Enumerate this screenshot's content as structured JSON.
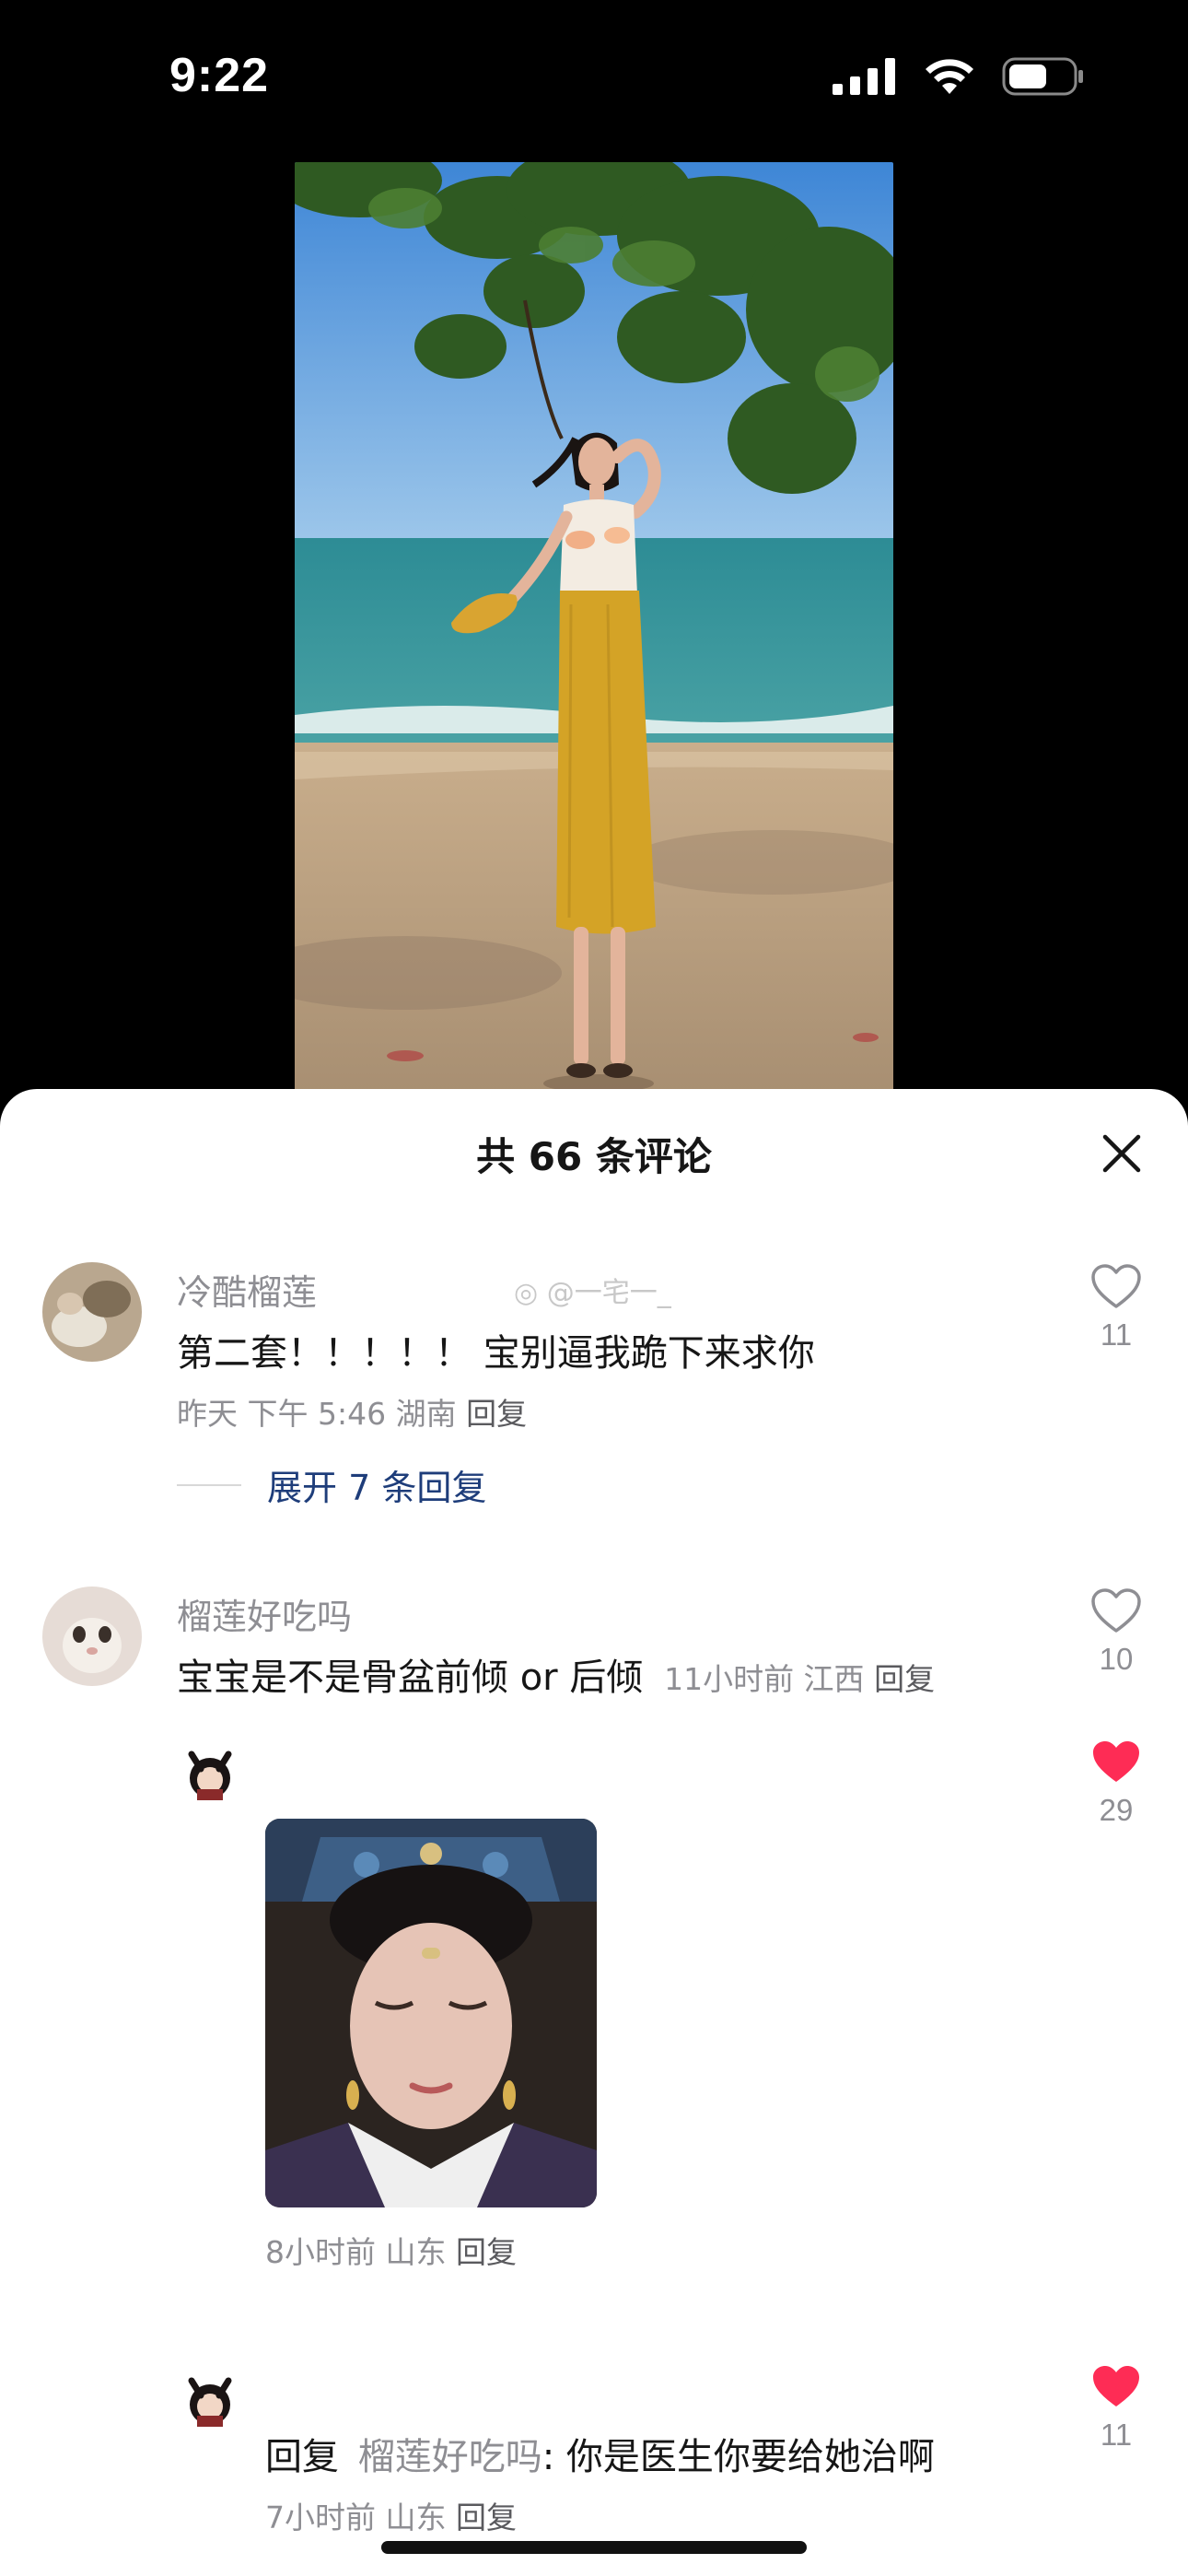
{
  "status_bar": {
    "time": "9:22"
  },
  "sheet": {
    "title": "共 66 条评论",
    "watermark": "@一宅一_"
  },
  "comments": [
    {
      "username": "冷酷榴莲",
      "text": "第二套！！！！！ 宝别逼我跪下来求你",
      "meta": "昨天 下午 5:46 湖南",
      "reply_label": "回复",
      "likes": "11",
      "liked": false,
      "expand_label": "展开 7 条回复"
    },
    {
      "username": "榴莲好吃吗",
      "text": "宝宝是不是骨盆前倾 or 后倾",
      "meta": "11小时前 江西",
      "reply_label": "回复",
      "likes": "10",
      "liked": false
    }
  ],
  "replies": [
    {
      "meta": "8小时前 山东",
      "reply_label": "回复",
      "likes": "29",
      "liked": true
    },
    {
      "reply_prefix": "回复",
      "reply_to": "榴莲好吃吗",
      "text": ": 你是医生你要给她治啊",
      "meta": "7小时前 山东",
      "reply_label": "回复",
      "likes": "11",
      "liked": true
    }
  ],
  "colors": {
    "accent_link": "#1e3d7a",
    "like_red": "#fe2c55",
    "muted": "#8e8e93"
  }
}
